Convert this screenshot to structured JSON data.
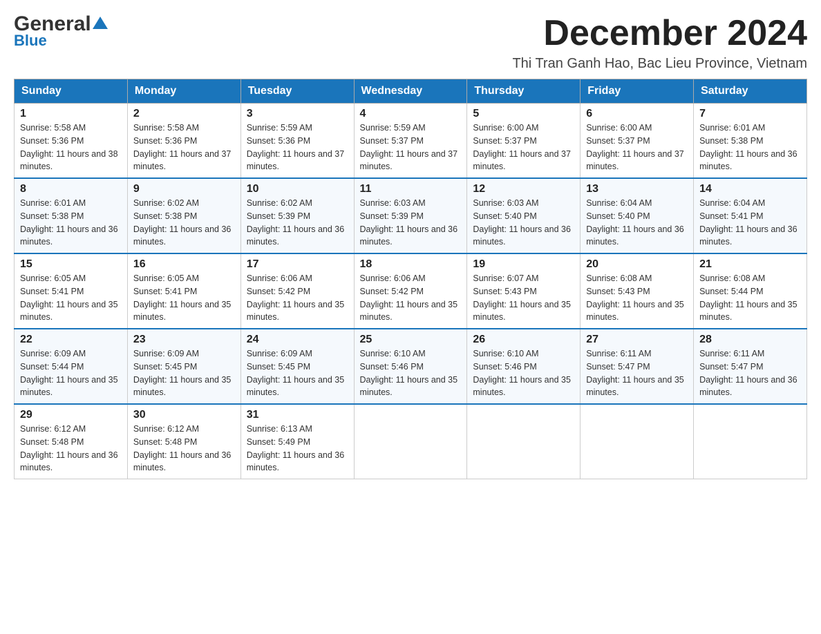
{
  "logo": {
    "general": "General",
    "blue": "Blue"
  },
  "header": {
    "month_year": "December 2024",
    "subtitle": "Thi Tran Ganh Hao, Bac Lieu Province, Vietnam"
  },
  "days_of_week": [
    "Sunday",
    "Monday",
    "Tuesday",
    "Wednesday",
    "Thursday",
    "Friday",
    "Saturday"
  ],
  "weeks": [
    [
      {
        "day": "1",
        "sunrise": "5:58 AM",
        "sunset": "5:36 PM",
        "daylight": "11 hours and 38 minutes."
      },
      {
        "day": "2",
        "sunrise": "5:58 AM",
        "sunset": "5:36 PM",
        "daylight": "11 hours and 37 minutes."
      },
      {
        "day": "3",
        "sunrise": "5:59 AM",
        "sunset": "5:36 PM",
        "daylight": "11 hours and 37 minutes."
      },
      {
        "day": "4",
        "sunrise": "5:59 AM",
        "sunset": "5:37 PM",
        "daylight": "11 hours and 37 minutes."
      },
      {
        "day": "5",
        "sunrise": "6:00 AM",
        "sunset": "5:37 PM",
        "daylight": "11 hours and 37 minutes."
      },
      {
        "day": "6",
        "sunrise": "6:00 AM",
        "sunset": "5:37 PM",
        "daylight": "11 hours and 37 minutes."
      },
      {
        "day": "7",
        "sunrise": "6:01 AM",
        "sunset": "5:38 PM",
        "daylight": "11 hours and 36 minutes."
      }
    ],
    [
      {
        "day": "8",
        "sunrise": "6:01 AM",
        "sunset": "5:38 PM",
        "daylight": "11 hours and 36 minutes."
      },
      {
        "day": "9",
        "sunrise": "6:02 AM",
        "sunset": "5:38 PM",
        "daylight": "11 hours and 36 minutes."
      },
      {
        "day": "10",
        "sunrise": "6:02 AM",
        "sunset": "5:39 PM",
        "daylight": "11 hours and 36 minutes."
      },
      {
        "day": "11",
        "sunrise": "6:03 AM",
        "sunset": "5:39 PM",
        "daylight": "11 hours and 36 minutes."
      },
      {
        "day": "12",
        "sunrise": "6:03 AM",
        "sunset": "5:40 PM",
        "daylight": "11 hours and 36 minutes."
      },
      {
        "day": "13",
        "sunrise": "6:04 AM",
        "sunset": "5:40 PM",
        "daylight": "11 hours and 36 minutes."
      },
      {
        "day": "14",
        "sunrise": "6:04 AM",
        "sunset": "5:41 PM",
        "daylight": "11 hours and 36 minutes."
      }
    ],
    [
      {
        "day": "15",
        "sunrise": "6:05 AM",
        "sunset": "5:41 PM",
        "daylight": "11 hours and 35 minutes."
      },
      {
        "day": "16",
        "sunrise": "6:05 AM",
        "sunset": "5:41 PM",
        "daylight": "11 hours and 35 minutes."
      },
      {
        "day": "17",
        "sunrise": "6:06 AM",
        "sunset": "5:42 PM",
        "daylight": "11 hours and 35 minutes."
      },
      {
        "day": "18",
        "sunrise": "6:06 AM",
        "sunset": "5:42 PM",
        "daylight": "11 hours and 35 minutes."
      },
      {
        "day": "19",
        "sunrise": "6:07 AM",
        "sunset": "5:43 PM",
        "daylight": "11 hours and 35 minutes."
      },
      {
        "day": "20",
        "sunrise": "6:08 AM",
        "sunset": "5:43 PM",
        "daylight": "11 hours and 35 minutes."
      },
      {
        "day": "21",
        "sunrise": "6:08 AM",
        "sunset": "5:44 PM",
        "daylight": "11 hours and 35 minutes."
      }
    ],
    [
      {
        "day": "22",
        "sunrise": "6:09 AM",
        "sunset": "5:44 PM",
        "daylight": "11 hours and 35 minutes."
      },
      {
        "day": "23",
        "sunrise": "6:09 AM",
        "sunset": "5:45 PM",
        "daylight": "11 hours and 35 minutes."
      },
      {
        "day": "24",
        "sunrise": "6:09 AM",
        "sunset": "5:45 PM",
        "daylight": "11 hours and 35 minutes."
      },
      {
        "day": "25",
        "sunrise": "6:10 AM",
        "sunset": "5:46 PM",
        "daylight": "11 hours and 35 minutes."
      },
      {
        "day": "26",
        "sunrise": "6:10 AM",
        "sunset": "5:46 PM",
        "daylight": "11 hours and 35 minutes."
      },
      {
        "day": "27",
        "sunrise": "6:11 AM",
        "sunset": "5:47 PM",
        "daylight": "11 hours and 35 minutes."
      },
      {
        "day": "28",
        "sunrise": "6:11 AM",
        "sunset": "5:47 PM",
        "daylight": "11 hours and 36 minutes."
      }
    ],
    [
      {
        "day": "29",
        "sunrise": "6:12 AM",
        "sunset": "5:48 PM",
        "daylight": "11 hours and 36 minutes."
      },
      {
        "day": "30",
        "sunrise": "6:12 AM",
        "sunset": "5:48 PM",
        "daylight": "11 hours and 36 minutes."
      },
      {
        "day": "31",
        "sunrise": "6:13 AM",
        "sunset": "5:49 PM",
        "daylight": "11 hours and 36 minutes."
      },
      null,
      null,
      null,
      null
    ]
  ]
}
